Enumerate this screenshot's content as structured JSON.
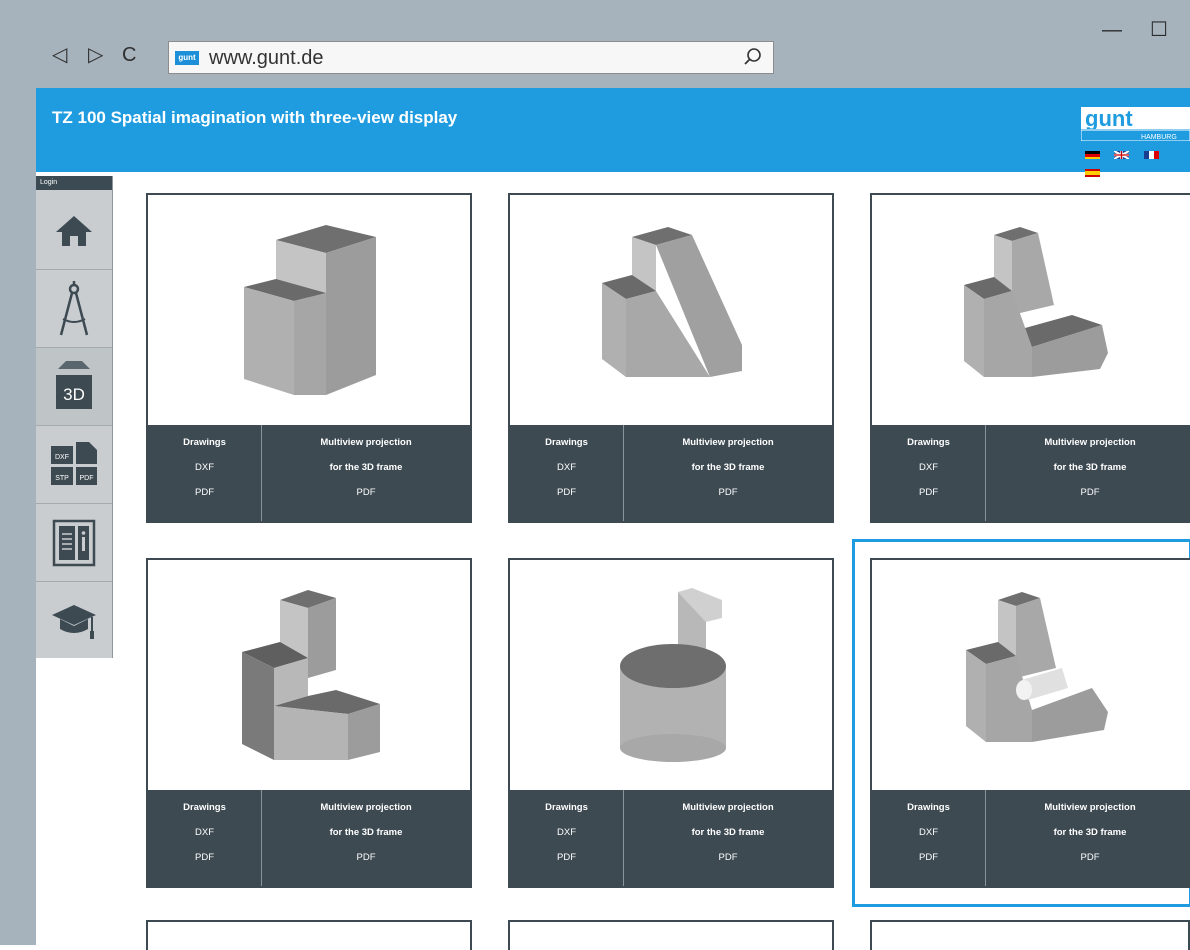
{
  "browser": {
    "url": "www.gunt.de",
    "favicon_text": "gunt",
    "minimize_glyph": "—",
    "maximize_glyph": "☐",
    "back_glyph": "◁",
    "forward_glyph": "▷",
    "reload_glyph": "C"
  },
  "header": {
    "title": "TZ 100 Spatial imagination with three-view display",
    "logo_text": "gunt",
    "logo_sub": "HAMBURG",
    "accent": "#1f9ce0"
  },
  "sidebar": {
    "login_label": "Login",
    "items": [
      {
        "icon": "home-icon"
      },
      {
        "icon": "compass-icon"
      },
      {
        "icon": "3d-model-icon",
        "label": "3D"
      },
      {
        "icon": "file-formats-icon",
        "labels": [
          "DXF",
          "STP",
          "PDF"
        ]
      },
      {
        "icon": "manual-info-icon"
      },
      {
        "icon": "graduation-cap-icon"
      }
    ]
  },
  "cards": [
    {
      "drawings": "Drawings",
      "dxf": "DXF",
      "pdf": "PDF",
      "proj1": "Multiview projection",
      "proj2": "for the 3D frame",
      "proj_pdf": "PDF"
    },
    {
      "drawings": "Drawings",
      "dxf": "DXF",
      "pdf": "PDF",
      "proj1": "Multiview projection",
      "proj2": "for the 3D frame",
      "proj_pdf": "PDF"
    },
    {
      "drawings": "Drawings",
      "dxf": "DXF",
      "pdf": "PDF",
      "proj1": "Multiview projection",
      "proj2": "for the 3D frame",
      "proj_pdf": "PDF"
    },
    {
      "drawings": "Drawings",
      "dxf": "DXF",
      "pdf": "PDF",
      "proj1": "Multiview projection",
      "proj2": "for the 3D frame",
      "proj_pdf": "PDF"
    },
    {
      "drawings": "Drawings",
      "dxf": "DXF",
      "pdf": "PDF",
      "proj1": "Multiview projection",
      "proj2": "for the 3D frame",
      "proj_pdf": "PDF"
    },
    {
      "drawings": "Drawings",
      "dxf": "DXF",
      "pdf": "PDF",
      "proj1": "Multiview projection",
      "proj2": "for the 3D frame",
      "proj_pdf": "PDF"
    }
  ]
}
